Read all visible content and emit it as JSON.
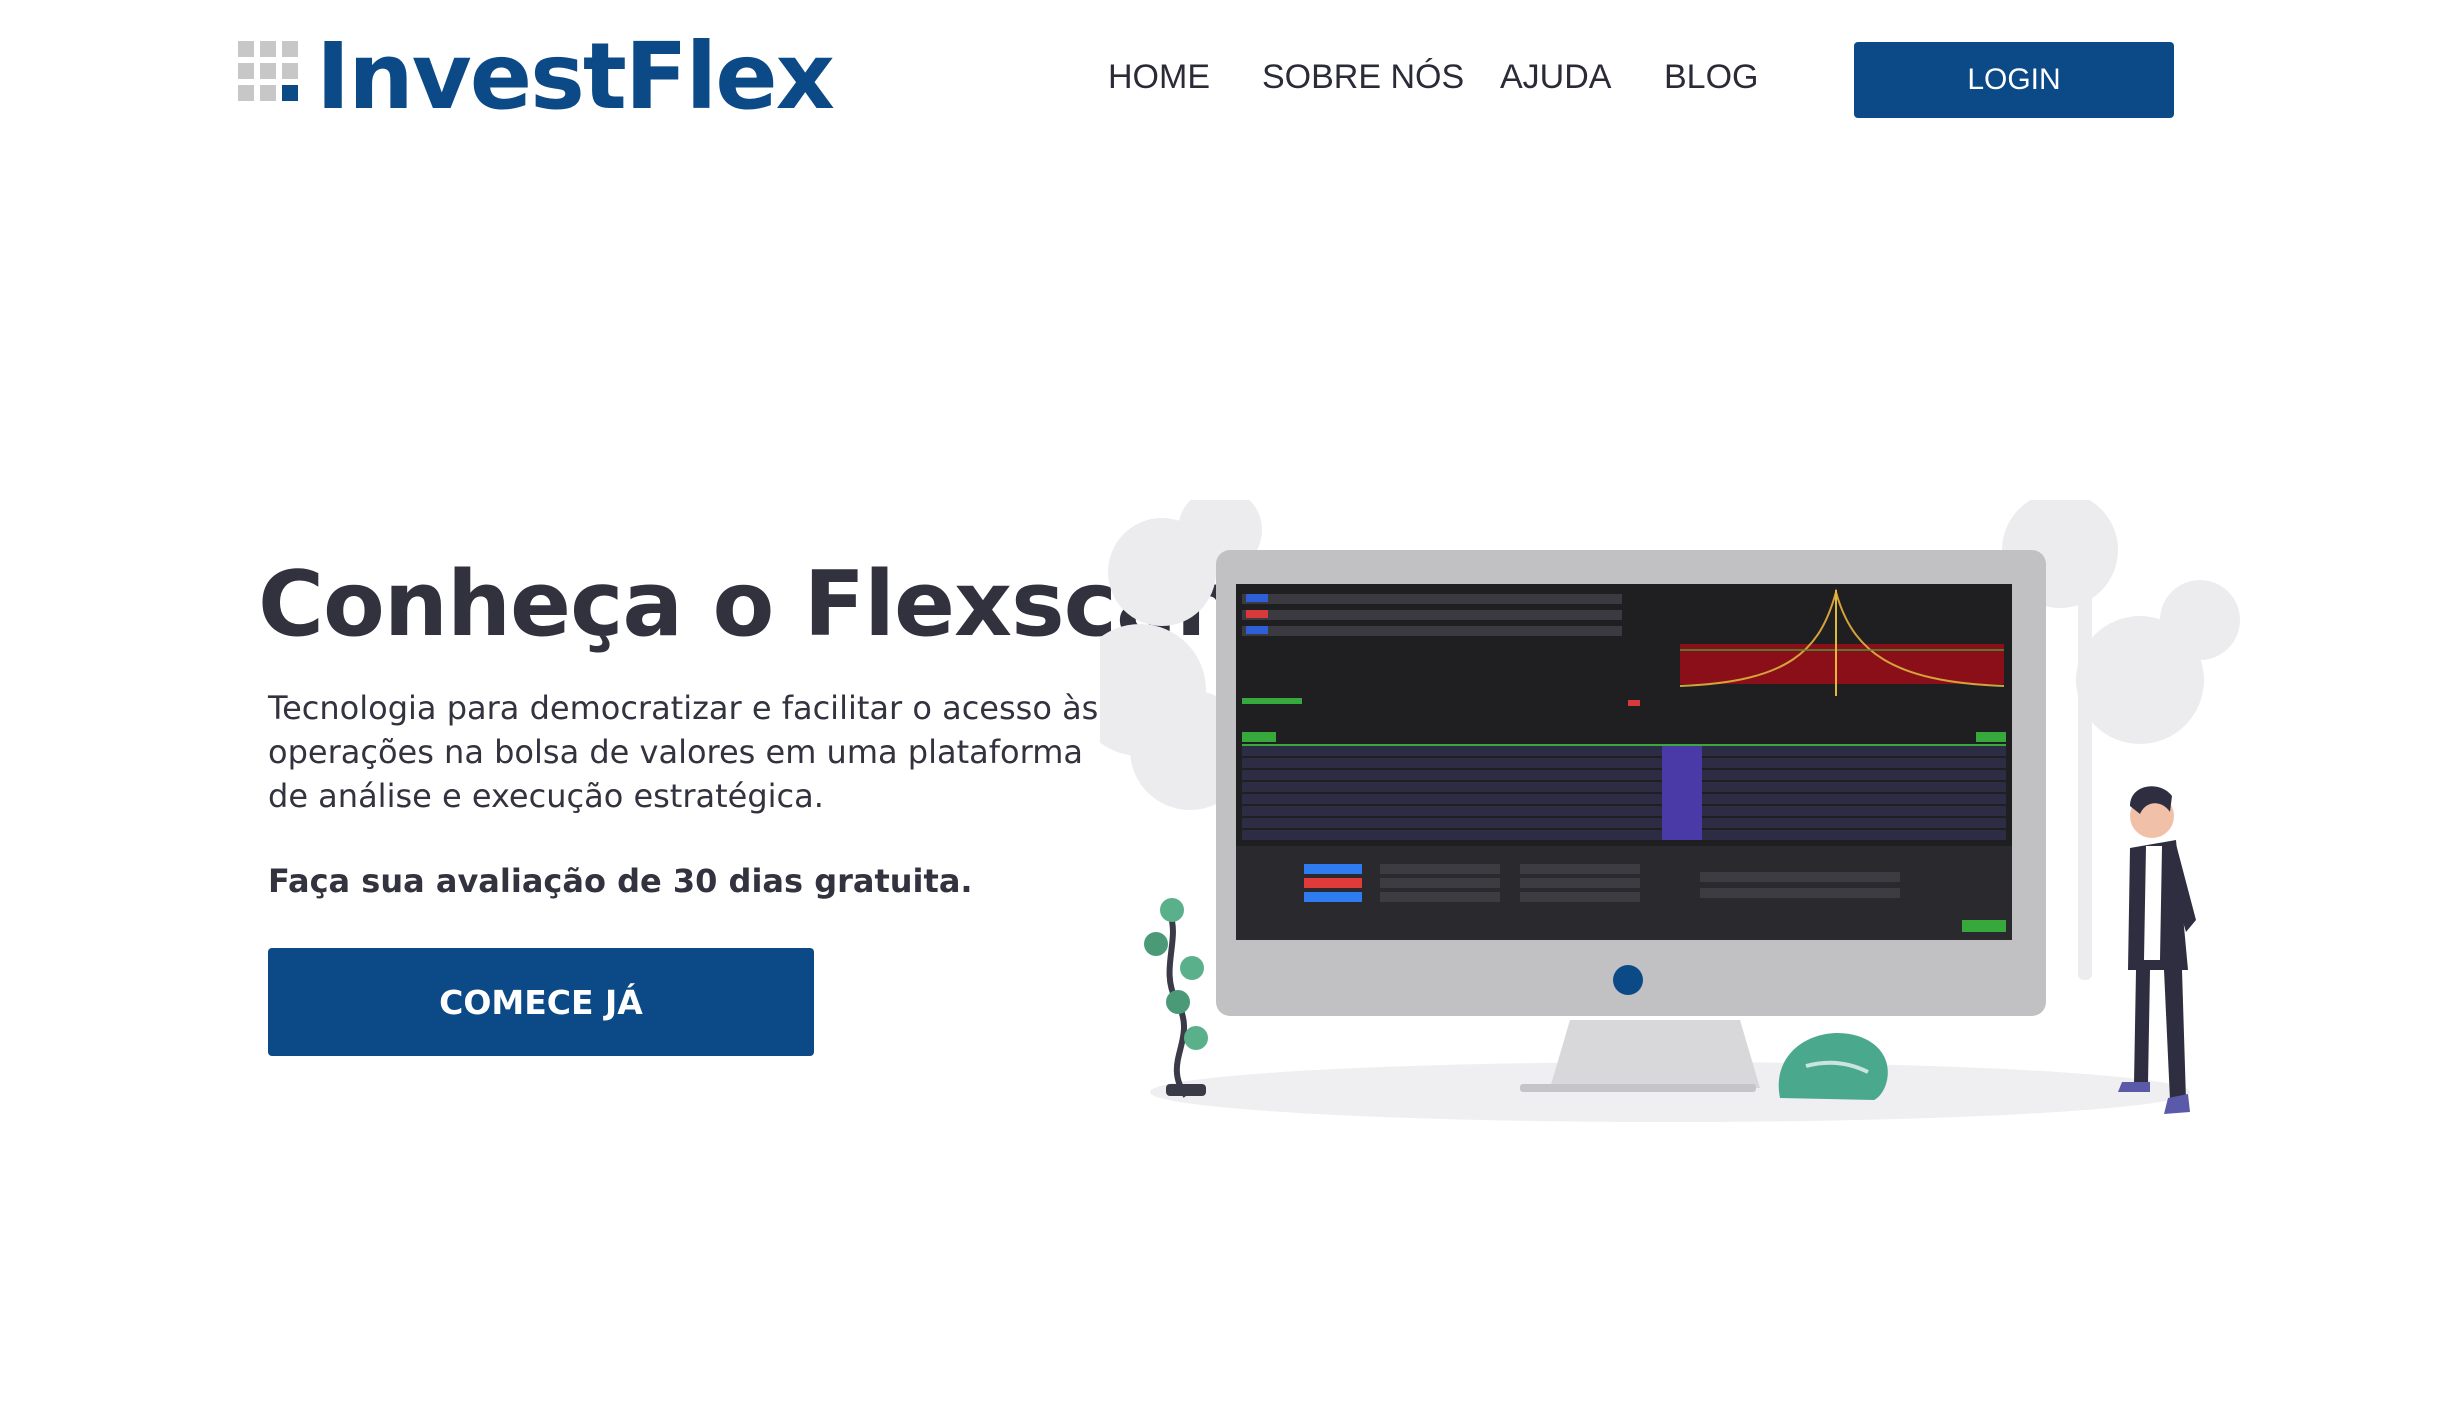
{
  "header": {
    "logo_text": "InvestFlex",
    "nav": [
      {
        "label": "HOME"
      },
      {
        "label": "SOBRE NÓS"
      },
      {
        "label": "AJUDA"
      },
      {
        "label": "BLOG"
      }
    ],
    "login_label": "LOGIN"
  },
  "hero": {
    "title": "Conheça o Flexscan",
    "description": "Tecnologia para democratizar e facilitar o acesso às operações na bolsa de valores em uma plataforma de análise e execução estratégica.",
    "cta_text": "Faça sua avaliação de 30 dias gratuita.",
    "button_label": "COMECE JÁ"
  },
  "colors": {
    "brand": "#0b4a86",
    "text": "#32323f",
    "background": "#ffffff"
  }
}
